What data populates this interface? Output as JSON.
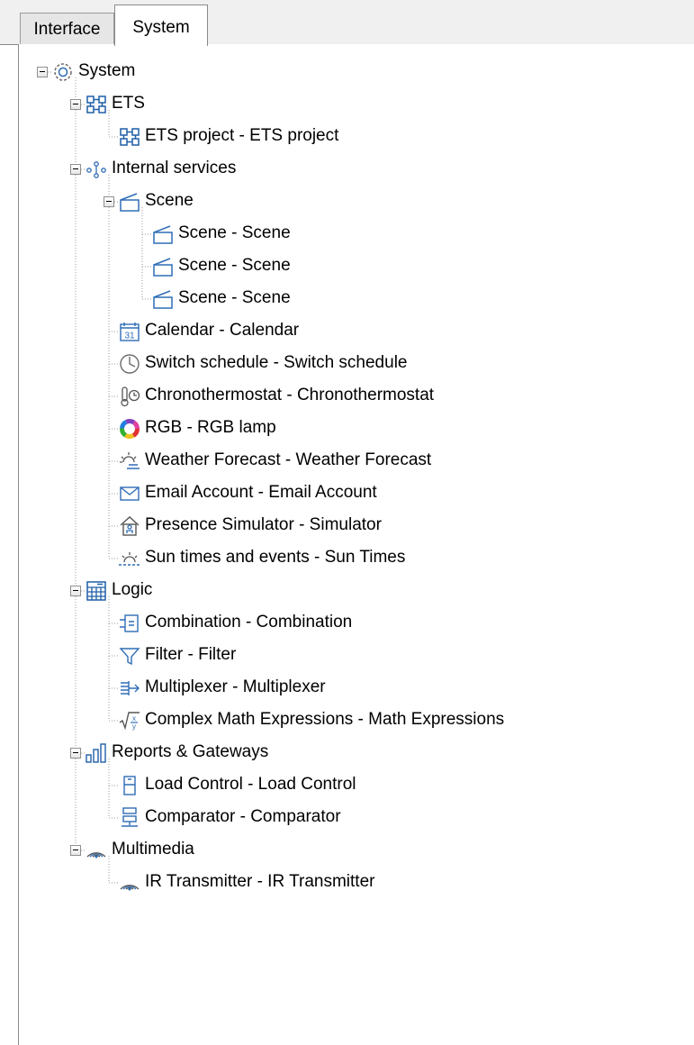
{
  "tabs": [
    {
      "label": "Interface",
      "active": false
    },
    {
      "label": "System",
      "active": true
    }
  ],
  "tree": [
    {
      "label": "System",
      "icon": "gear-icon",
      "depth": 0,
      "expanded": true,
      "children": [
        {
          "label": "ETS",
          "icon": "ets-icon",
          "depth": 1,
          "expanded": true,
          "children": [
            {
              "label": "ETS project - ETS project",
              "icon": "ets-icon",
              "depth": 2
            }
          ]
        },
        {
          "label": "Internal services",
          "icon": "services-icon",
          "depth": 1,
          "expanded": true,
          "children": [
            {
              "label": "Scene",
              "icon": "scene-icon",
              "depth": 2,
              "expanded": true,
              "children": [
                {
                  "label": "Scene - Scene",
                  "icon": "scene-icon",
                  "depth": 3
                },
                {
                  "label": "Scene - Scene",
                  "icon": "scene-icon",
                  "depth": 3
                },
                {
                  "label": "Scene - Scene",
                  "icon": "scene-icon",
                  "depth": 3
                }
              ]
            },
            {
              "label": "Calendar - Calendar",
              "icon": "calendar-icon",
              "depth": 2
            },
            {
              "label": "Switch schedule - Switch schedule",
              "icon": "clock-icon",
              "depth": 2
            },
            {
              "label": "Chronothermostat - Chronothermostat",
              "icon": "thermostat-icon",
              "depth": 2
            },
            {
              "label": "RGB - RGB lamp",
              "icon": "rgb-ring-icon",
              "depth": 2
            },
            {
              "label": "Weather Forecast - Weather Forecast",
              "icon": "weather-icon",
              "depth": 2
            },
            {
              "label": "Email Account - Email Account",
              "icon": "envelope-icon",
              "depth": 2
            },
            {
              "label": "Presence Simulator - Simulator",
              "icon": "house-person-icon",
              "depth": 2
            },
            {
              "label": "Sun times and events - Sun Times",
              "icon": "sun-horizon-icon",
              "depth": 2
            }
          ]
        },
        {
          "label": "Logic",
          "icon": "grid-calc-icon",
          "depth": 1,
          "expanded": true,
          "children": [
            {
              "label": "Combination - Combination",
              "icon": "combination-icon",
              "depth": 2
            },
            {
              "label": "Filter - Filter",
              "icon": "filter-icon",
              "depth": 2
            },
            {
              "label": "Multiplexer - Multiplexer",
              "icon": "multiplexer-icon",
              "depth": 2
            },
            {
              "label": "Complex Math Expressions - Math Expressions",
              "icon": "sqrt-icon",
              "depth": 2
            }
          ]
        },
        {
          "label": "Reports & Gateways",
          "icon": "bar-chart-icon",
          "depth": 1,
          "expanded": true,
          "children": [
            {
              "label": "Load Control - Load Control",
              "icon": "load-control-icon",
              "depth": 2
            },
            {
              "label": "Comparator - Comparator",
              "icon": "comparator-icon",
              "depth": 2
            }
          ]
        },
        {
          "label": "Multimedia",
          "icon": "signal-icon",
          "depth": 1,
          "expanded": true,
          "children": [
            {
              "label": "IR Transmitter - IR Transmitter",
              "icon": "signal-icon",
              "depth": 2
            }
          ]
        }
      ]
    }
  ]
}
